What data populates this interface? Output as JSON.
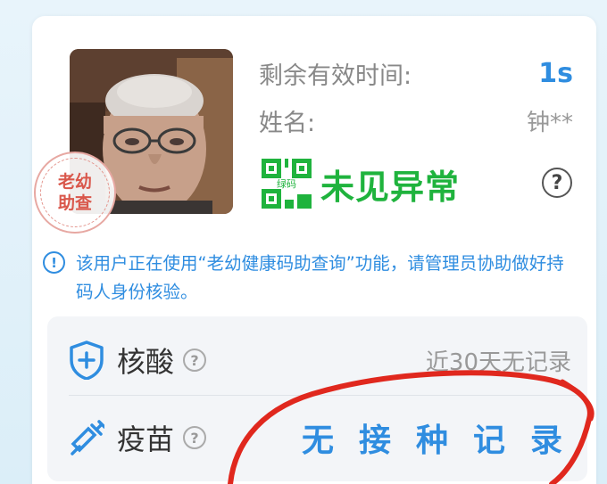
{
  "info": {
    "remaining_label": "剩余有效时间:",
    "remaining_value": "1s",
    "name_label": "姓名:",
    "name_value": "钟**"
  },
  "stamp": {
    "line1": "老幼",
    "line2": "助查"
  },
  "status": {
    "qr_label": "绿码",
    "text": "未见异常",
    "help": "?"
  },
  "notice": {
    "icon": "!",
    "text": "该用户正在使用“老幼健康码助查询”功能，请管理员协助做好持码人身份核验。"
  },
  "records": {
    "nucleic": {
      "label": "核酸",
      "q": "?",
      "value": "近30天无记录"
    },
    "vaccine": {
      "label": "疫苗",
      "q": "?",
      "value": "无接种记录"
    }
  },
  "colors": {
    "accent_blue": "#2f8de0",
    "status_green": "#1fb33d",
    "stamp_red": "#d9574b",
    "annotation_red": "#e0281e"
  },
  "icons": {
    "photo": "person-photo",
    "nucleic": "shield-plus-icon",
    "vaccine": "syringe-icon"
  }
}
